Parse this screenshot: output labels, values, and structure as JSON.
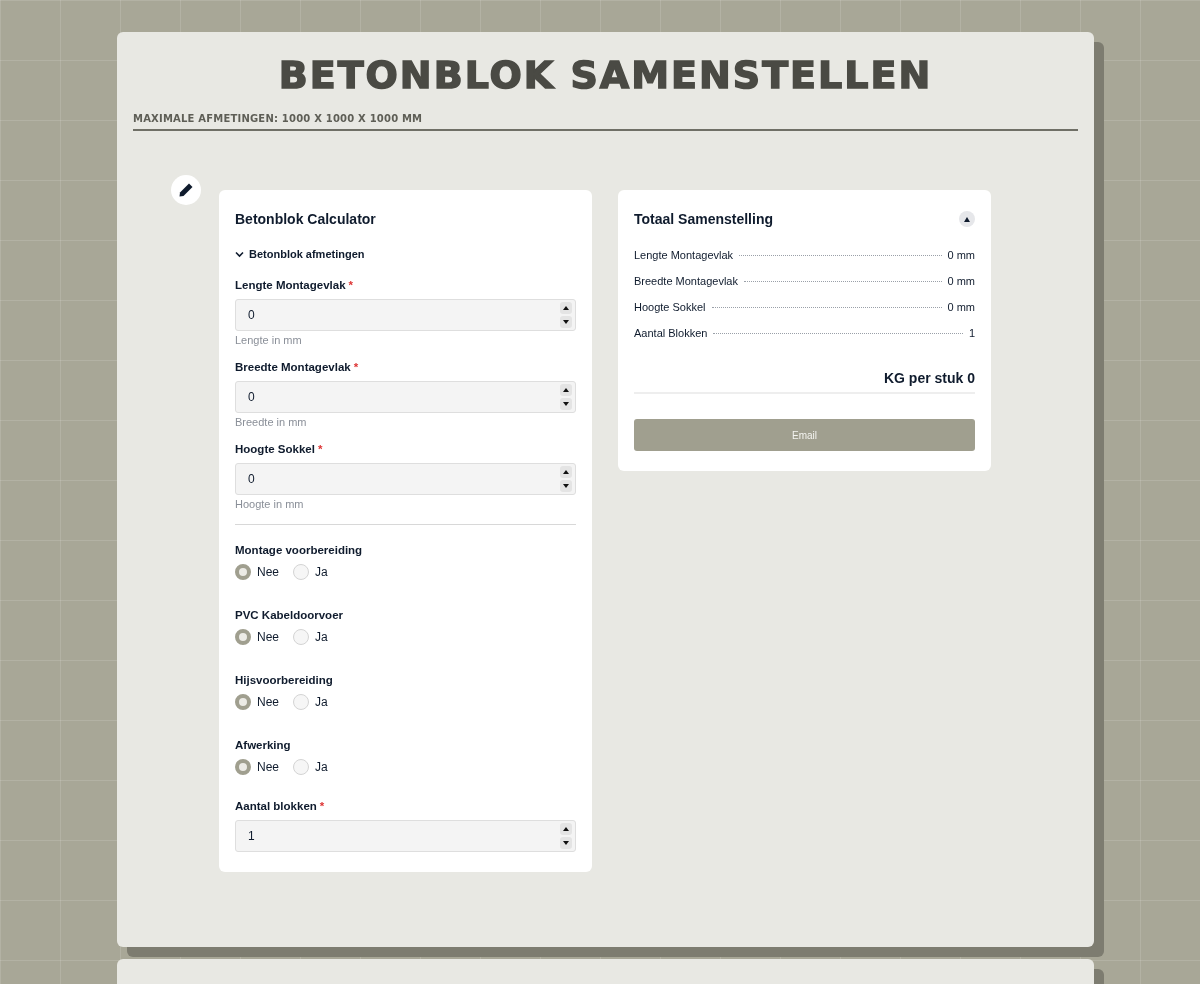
{
  "header": {
    "title": "BETONBLOK SAMENSTELLEN",
    "subtitle": "MAXIMALE AFMETINGEN: 1000 X 1000 X 1000 MM"
  },
  "calculator": {
    "title": "Betonblok Calculator",
    "section": {
      "label": "Betonblok afmetingen",
      "expanded": true
    },
    "dimension_fields": [
      {
        "label": "Lengte Montagevlak",
        "required_mark": "*",
        "value": "0",
        "hint": "Lengte in mm"
      },
      {
        "label": "Breedte Montagevlak",
        "required_mark": "*",
        "value": "0",
        "hint": "Breedte in mm"
      },
      {
        "label": "Hoogte Sokkel",
        "required_mark": "*",
        "value": "0",
        "hint": "Hoogte in mm"
      }
    ],
    "options": [
      {
        "label": "Montage voorbereiding",
        "choices": [
          {
            "label": "Nee",
            "selected": true
          },
          {
            "label": "Ja",
            "selected": false
          }
        ]
      },
      {
        "label": "PVC Kabeldoorvoer",
        "choices": [
          {
            "label": "Nee",
            "selected": true
          },
          {
            "label": "Ja",
            "selected": false
          }
        ]
      },
      {
        "label": "Hijsvoorbereiding",
        "choices": [
          {
            "label": "Nee",
            "selected": true
          },
          {
            "label": "Ja",
            "selected": false
          }
        ]
      },
      {
        "label": "Afwerking",
        "choices": [
          {
            "label": "Nee",
            "selected": true
          },
          {
            "label": "Ja",
            "selected": false
          }
        ]
      }
    ],
    "count_field": {
      "label": "Aantal blokken",
      "required_mark": "*",
      "value": "1"
    }
  },
  "summary": {
    "title": "Totaal Samenstelling",
    "expanded": true,
    "rows": [
      {
        "label": "Lengte Montagevlak",
        "value": "0 mm"
      },
      {
        "label": "Breedte Montagevlak",
        "value": "0 mm"
      },
      {
        "label": "Hoogte Sokkel",
        "value": "0 mm"
      },
      {
        "label": "Aantal Blokken",
        "value": "1"
      }
    ],
    "total": "KG per stuk 0",
    "button": "Email"
  }
}
